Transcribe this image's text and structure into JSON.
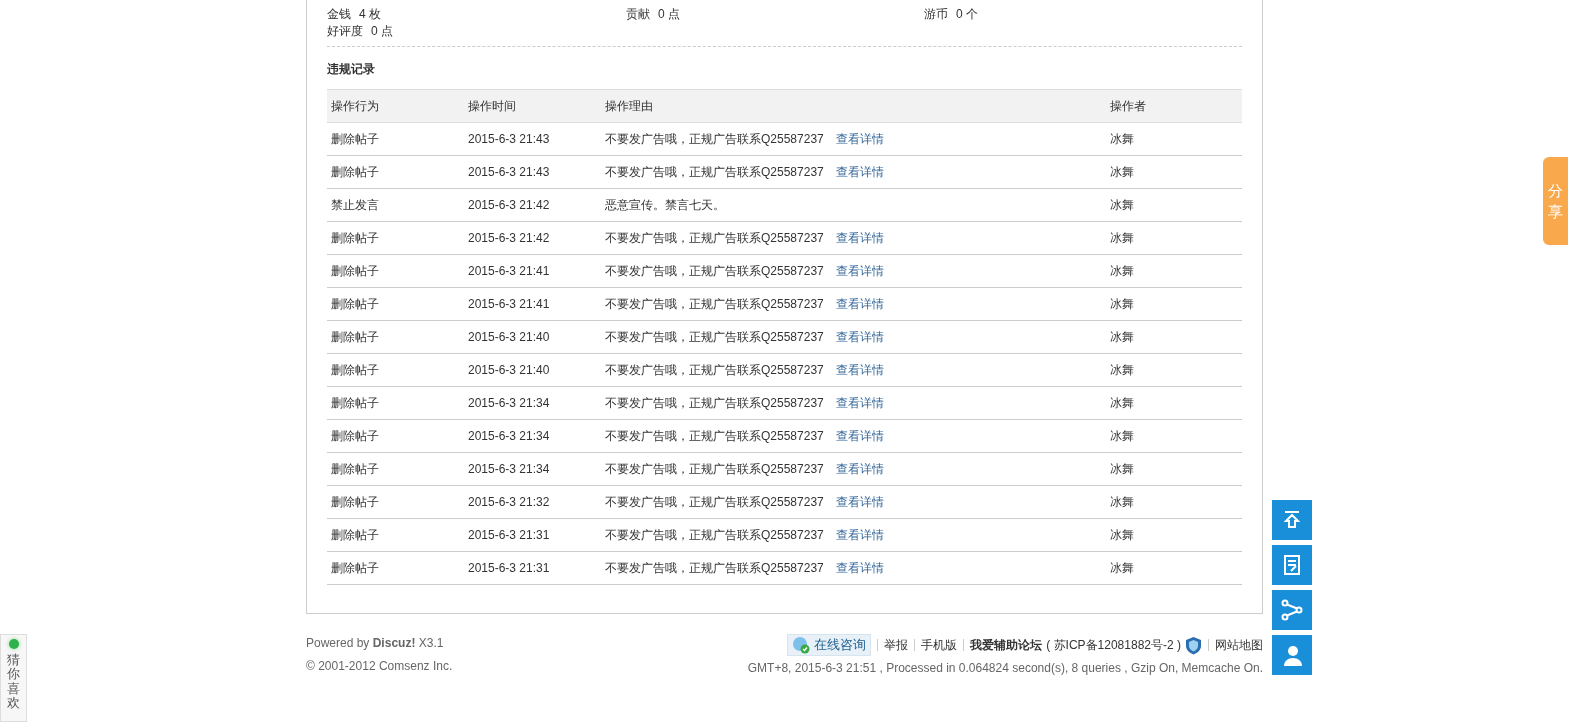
{
  "stats": [
    {
      "label": "金钱",
      "value": "4 枚"
    },
    {
      "label": "贡献",
      "value": "0 点"
    },
    {
      "label": "游币",
      "value": "0 个"
    },
    {
      "label": "好评度",
      "value": "0 点"
    }
  ],
  "section_title": "违规记录",
  "table": {
    "columns": [
      "操作行为",
      "操作时间",
      "操作理由",
      "操作者"
    ],
    "rows": [
      {
        "action": "删除帖子",
        "time": "2015-6-3 21:43",
        "reason": "不要发广告哦，正规广告联系Q25587237",
        "link": "查看详情",
        "operator": "冰舞"
      },
      {
        "action": "删除帖子",
        "time": "2015-6-3 21:43",
        "reason": "不要发广告哦，正规广告联系Q25587237",
        "link": "查看详情",
        "operator": "冰舞"
      },
      {
        "action": "禁止发言",
        "time": "2015-6-3 21:42",
        "reason": "恶意宣传。禁言七天。",
        "operator": "冰舞"
      },
      {
        "action": "删除帖子",
        "time": "2015-6-3 21:42",
        "reason": "不要发广告哦，正规广告联系Q25587237",
        "link": "查看详情",
        "operator": "冰舞"
      },
      {
        "action": "删除帖子",
        "time": "2015-6-3 21:41",
        "reason": "不要发广告哦，正规广告联系Q25587237",
        "link": "查看详情",
        "operator": "冰舞"
      },
      {
        "action": "删除帖子",
        "time": "2015-6-3 21:41",
        "reason": "不要发广告哦，正规广告联系Q25587237",
        "link": "查看详情",
        "operator": "冰舞"
      },
      {
        "action": "删除帖子",
        "time": "2015-6-3 21:40",
        "reason": "不要发广告哦，正规广告联系Q25587237",
        "link": "查看详情",
        "operator": "冰舞"
      },
      {
        "action": "删除帖子",
        "time": "2015-6-3 21:40",
        "reason": "不要发广告哦，正规广告联系Q25587237",
        "link": "查看详情",
        "operator": "冰舞"
      },
      {
        "action": "删除帖子",
        "time": "2015-6-3 21:34",
        "reason": "不要发广告哦，正规广告联系Q25587237",
        "link": "查看详情",
        "operator": "冰舞"
      },
      {
        "action": "删除帖子",
        "time": "2015-6-3 21:34",
        "reason": "不要发广告哦，正规广告联系Q25587237",
        "link": "查看详情",
        "operator": "冰舞"
      },
      {
        "action": "删除帖子",
        "time": "2015-6-3 21:34",
        "reason": "不要发广告哦，正规广告联系Q25587237",
        "link": "查看详情",
        "operator": "冰舞"
      },
      {
        "action": "删除帖子",
        "time": "2015-6-3 21:32",
        "reason": "不要发广告哦，正规广告联系Q25587237",
        "link": "查看详情",
        "operator": "冰舞"
      },
      {
        "action": "删除帖子",
        "time": "2015-6-3 21:31",
        "reason": "不要发广告哦，正规广告联系Q25587237",
        "link": "查看详情",
        "operator": "冰舞"
      },
      {
        "action": "删除帖子",
        "time": "2015-6-3 21:31",
        "reason": "不要发广告哦，正规广告联系Q25587237",
        "link": "查看详情",
        "operator": "冰舞"
      }
    ]
  },
  "footer": {
    "powered": "Powered by **Discuz!** X3.1",
    "copyright": "© 2001-2012 Comsenz Inc.",
    "consult_button": "在线咨询",
    "links": [
      {
        "kind": "link",
        "text": "举报"
      },
      {
        "kind": "link",
        "text": "手机版"
      },
      {
        "kind": "site",
        "text": "我爱辅助论坛",
        "extra": "( 苏ICP备12081882号-2 )"
      },
      {
        "kind": "link",
        "text": "网站地图"
      }
    ],
    "status": "GMT+8, 2015-6-3 21:51 , Processed in 0.064824 second(s), 8 queries , Gzip On, Memcache On."
  },
  "share_tab": "分享",
  "recommend_widget": "猜你喜欢"
}
